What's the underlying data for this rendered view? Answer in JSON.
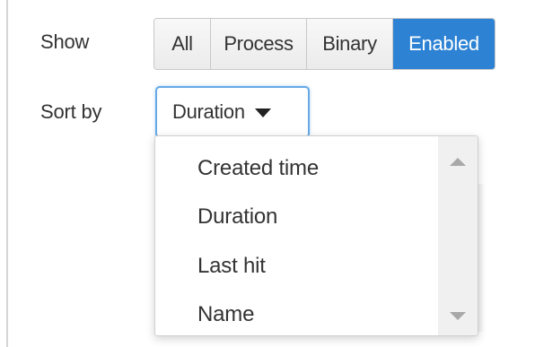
{
  "filters": {
    "show_label": "Show",
    "sort_label": "Sort by",
    "show_options": [
      {
        "label": "All",
        "selected": false
      },
      {
        "label": "Process",
        "selected": false
      },
      {
        "label": "Binary",
        "selected": false
      },
      {
        "label": "Enabled",
        "selected": true
      }
    ],
    "sort_selected": "Duration"
  },
  "sort_dropdown": {
    "options": [
      "Created time",
      "Duration",
      "Last hit",
      "Name"
    ],
    "open": true
  },
  "colors": {
    "accent": "#2d82d4",
    "focus_ring": "#66a9e6",
    "text": "#333333"
  },
  "icons": {
    "select_caret": "caret-down-icon",
    "scroll_up": "scroll-up-arrow-icon",
    "scroll_down": "scroll-down-arrow-icon"
  }
}
